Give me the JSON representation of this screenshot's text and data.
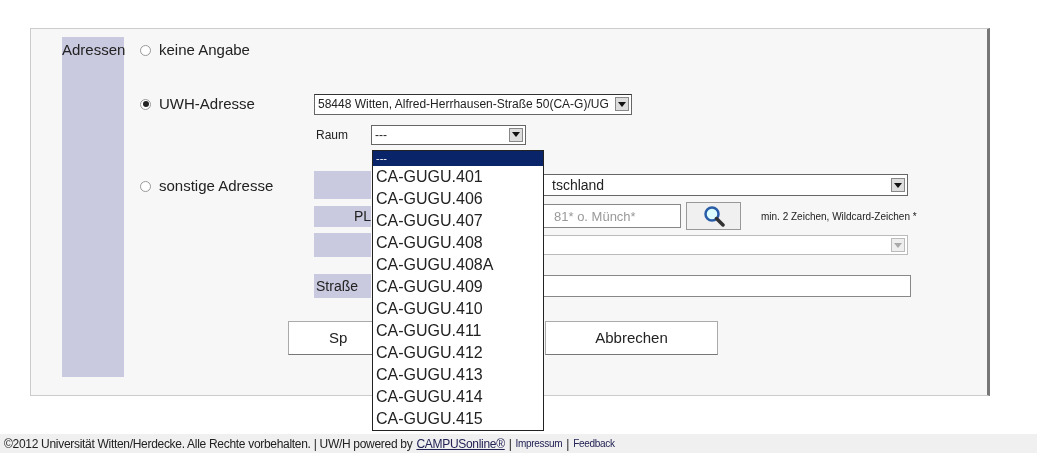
{
  "field_label": "Adressen",
  "options": [
    {
      "label": "keine Angabe",
      "selected": false
    },
    {
      "label": "UWH-Adresse",
      "selected": true
    },
    {
      "label": "sonstige Adresse",
      "selected": false
    }
  ],
  "uwh_address": {
    "value": "58448 Witten, Alfred-Herrhausen-Straße 50(CA-G)/UG"
  },
  "room": {
    "label": "Raum",
    "value": "---",
    "list": [
      {
        "label": "---",
        "selected": true
      },
      {
        "label": "CA-GUGU.401",
        "selected": false
      },
      {
        "label": "CA-GUGU.406",
        "selected": false
      },
      {
        "label": "CA-GUGU.407",
        "selected": false
      },
      {
        "label": "CA-GUGU.408",
        "selected": false
      },
      {
        "label": "CA-GUGU.408A",
        "selected": false
      },
      {
        "label": "CA-GUGU.409",
        "selected": false
      },
      {
        "label": "CA-GUGU.410",
        "selected": false
      },
      {
        "label": "CA-GUGU.411",
        "selected": false
      },
      {
        "label": "CA-GUGU.412",
        "selected": false
      },
      {
        "label": "CA-GUGU.413",
        "selected": false
      },
      {
        "label": "CA-GUGU.414",
        "selected": false
      },
      {
        "label": "CA-GUGU.415",
        "selected": false
      }
    ]
  },
  "other_address": {
    "country": {
      "value": "tschland"
    },
    "postcode": {
      "label": "PL",
      "placeholder": "81* o. Münch*",
      "hint": "min. 2 Zeichen, Wildcard-Zeichen *"
    },
    "city": {
      "disabled": true
    },
    "street": {
      "label": "Straße"
    }
  },
  "buttons": [
    "Sp",
    "Abbrechen"
  ],
  "footer": {
    "copyright": "©2012 Universität Witten/Herdecke. Alle Rechte vorbehalten. | UW/H powered by",
    "items": [
      {
        "kind": "link",
        "text": "CAMPUSonline®"
      },
      {
        "kind": "separator",
        "text": "|"
      },
      {
        "kind": "small_link",
        "text": "Impressum"
      },
      {
        "kind": "separator",
        "text": "|"
      },
      {
        "kind": "small_link",
        "text": "Feedback"
      }
    ]
  }
}
